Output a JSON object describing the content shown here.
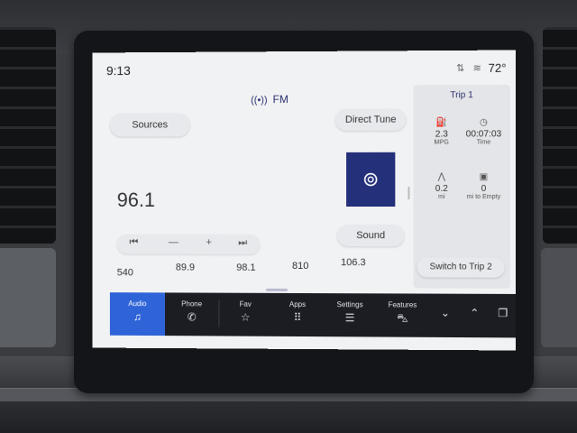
{
  "status": {
    "time": "9:13",
    "temperature": "72°"
  },
  "source": {
    "title": "FM"
  },
  "buttons": {
    "sources": "Sources",
    "direct_tune": "Direct Tune",
    "sound": "Sound",
    "switch_trip": "Switch to Trip 2"
  },
  "tuner": {
    "frequency": "96.1",
    "seek_back_icon": "seek-back-icon",
    "minus_icon": "minus-icon",
    "plus_icon": "plus-icon",
    "seek_forward_icon": "seek-forward-icon"
  },
  "presets": [
    "540",
    "89.9",
    "98.1",
    "810",
    "106.3"
  ],
  "trip": {
    "title": "Trip 1",
    "mpg_value": "2.3",
    "mpg_unit": "MPG",
    "time_value": "00:07:03",
    "time_unit": "Time",
    "distance_value": "0.2",
    "distance_unit": "mi",
    "empty_value": "0",
    "empty_unit": "mi to Empty"
  },
  "nav": {
    "audio": "Audio",
    "phone": "Phone",
    "fav": "Fav",
    "apps": "Apps",
    "settings": "Settings",
    "features": "Features"
  },
  "colors": {
    "accent": "#2f63d8",
    "radio_tile": "#25307a",
    "navbar": "#1b1d22"
  }
}
